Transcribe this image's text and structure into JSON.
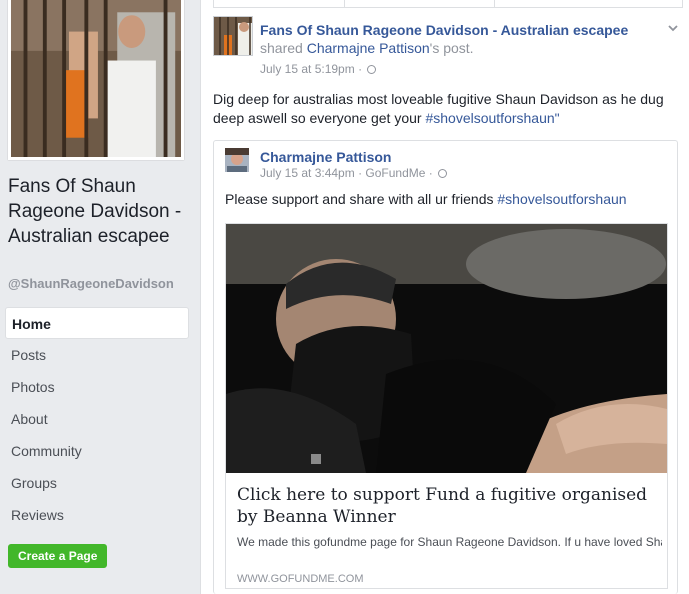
{
  "page": {
    "name": "Fans Of Shaun Rageone Davidson - Australian escapee",
    "handle": "@ShaunRageoneDavidson"
  },
  "nav": {
    "items": [
      {
        "label": "Home",
        "active": true
      },
      {
        "label": "Posts"
      },
      {
        "label": "Photos"
      },
      {
        "label": "About"
      },
      {
        "label": "Community"
      },
      {
        "label": "Groups"
      },
      {
        "label": "Reviews"
      }
    ],
    "create_page_label": "Create a Page"
  },
  "post": {
    "author": "Fans Of Shaun Rageone Davidson - Australian escapee",
    "shared_prefix": "shared",
    "shared_from": "Charmajne Pattison",
    "shared_suffix": "'s post.",
    "timestamp": "July 15 at 5:19pm",
    "text": "Dig deep for australias most loveable fugitive Shaun Davidson as he dug deep aswell so everyone get your",
    "hashtag": "#shovelsoutforshaun\""
  },
  "shared_post": {
    "author": "Charmajne Pattison",
    "timestamp": "July 15 at 3:44pm",
    "source": "GoFundMe",
    "text": "Please support and share with all ur friends",
    "hashtag": "#shovelsoutforshaun",
    "link": {
      "title": "Click here to support Fund a fugitive organised by Beanna Winner",
      "description": "We made this gofundme page for Shaun Rageone Davidson. If u have loved Shauns \"catch me if u can\" antics as much as we have so far and just like us...",
      "domain": "WWW.GOFUNDME.COM"
    }
  },
  "colors": {
    "link_blue": "#365899",
    "create_green": "#42b72a",
    "background": "#e9ebee"
  }
}
